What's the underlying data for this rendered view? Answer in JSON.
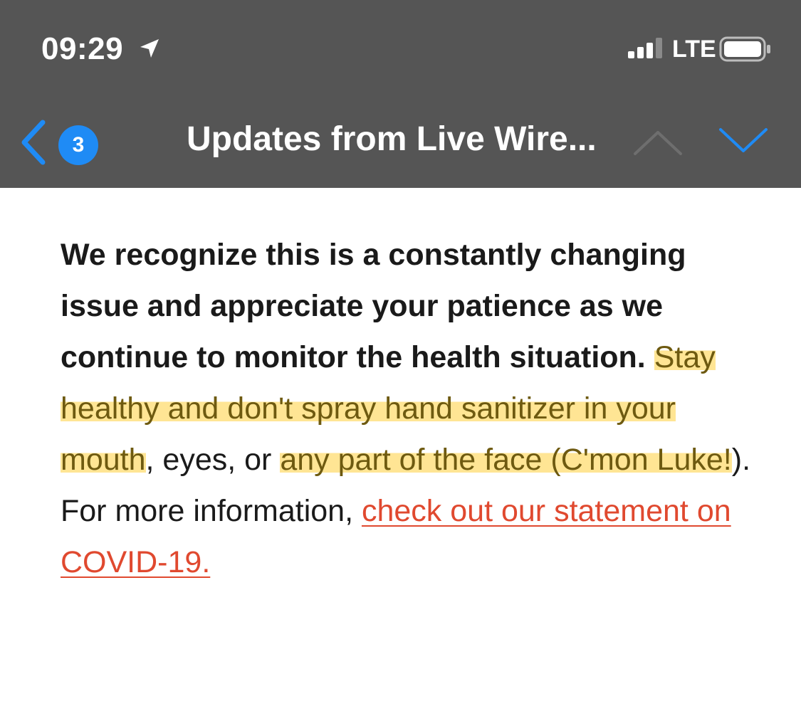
{
  "status_bar": {
    "time": "09:29",
    "network": "LTE",
    "location_icon": "location-arrow-icon",
    "signal_icon": "cellular-signal-icon",
    "battery_icon": "battery-icon"
  },
  "nav": {
    "back_icon": "chevron-left-icon",
    "unread_count": "3",
    "title": "Updates from Live Wire...",
    "prev_icon": "chevron-up-icon",
    "next_icon": "chevron-down-icon"
  },
  "email": {
    "bold_text": "We recognize this is a constantly changing issue and appreciate your patience as we continue to monitor the health situation.",
    "highlighted_text": "Stay healthy and don't spray hand sanitizer in your mouth",
    "text_after_highlight_1": ", eyes, or ",
    "highlighted_text_2": "any part of the face (C'mon Luke!",
    "text_after_highlight_2": "). For more information, ",
    "link_text": "check out our statement on COVID-19. "
  },
  "colors": {
    "toolbar_bg": "#555555",
    "accent_blue": "#1f8bf5",
    "link_red": "#e0492f",
    "highlight_yellow": "#ffd03c"
  }
}
